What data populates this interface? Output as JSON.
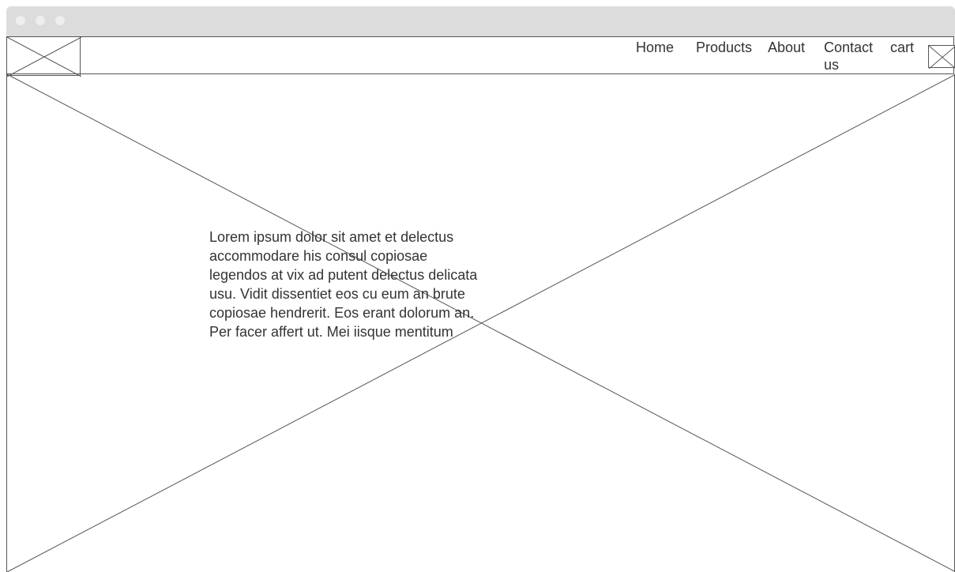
{
  "header": {
    "logo_icon": "image-placeholder-icon",
    "nav_items": [
      {
        "label": "Home"
      },
      {
        "label": "Products"
      },
      {
        "label": "About"
      },
      {
        "label": "Contact us"
      },
      {
        "label": "cart"
      }
    ],
    "cart_icon": "image-placeholder-icon"
  },
  "hero": {
    "background_icon": "image-placeholder-icon",
    "text": "Lorem ipsum dolor sit amet et delectus accommodare his consul copiosae legendos at vix ad putent delectus delicata usu. Vidit dissentiet eos cu eum an brute copiosae hendrerit. Eos erant dolorum an. Per facer affert ut. Mei iisque mentitum"
  },
  "colors": {
    "titlebar": "#dcdcdc",
    "traffic_lights": "#eeeeee",
    "wireframe_lines": "#555555",
    "text": "#333333",
    "background": "#ffffff"
  }
}
